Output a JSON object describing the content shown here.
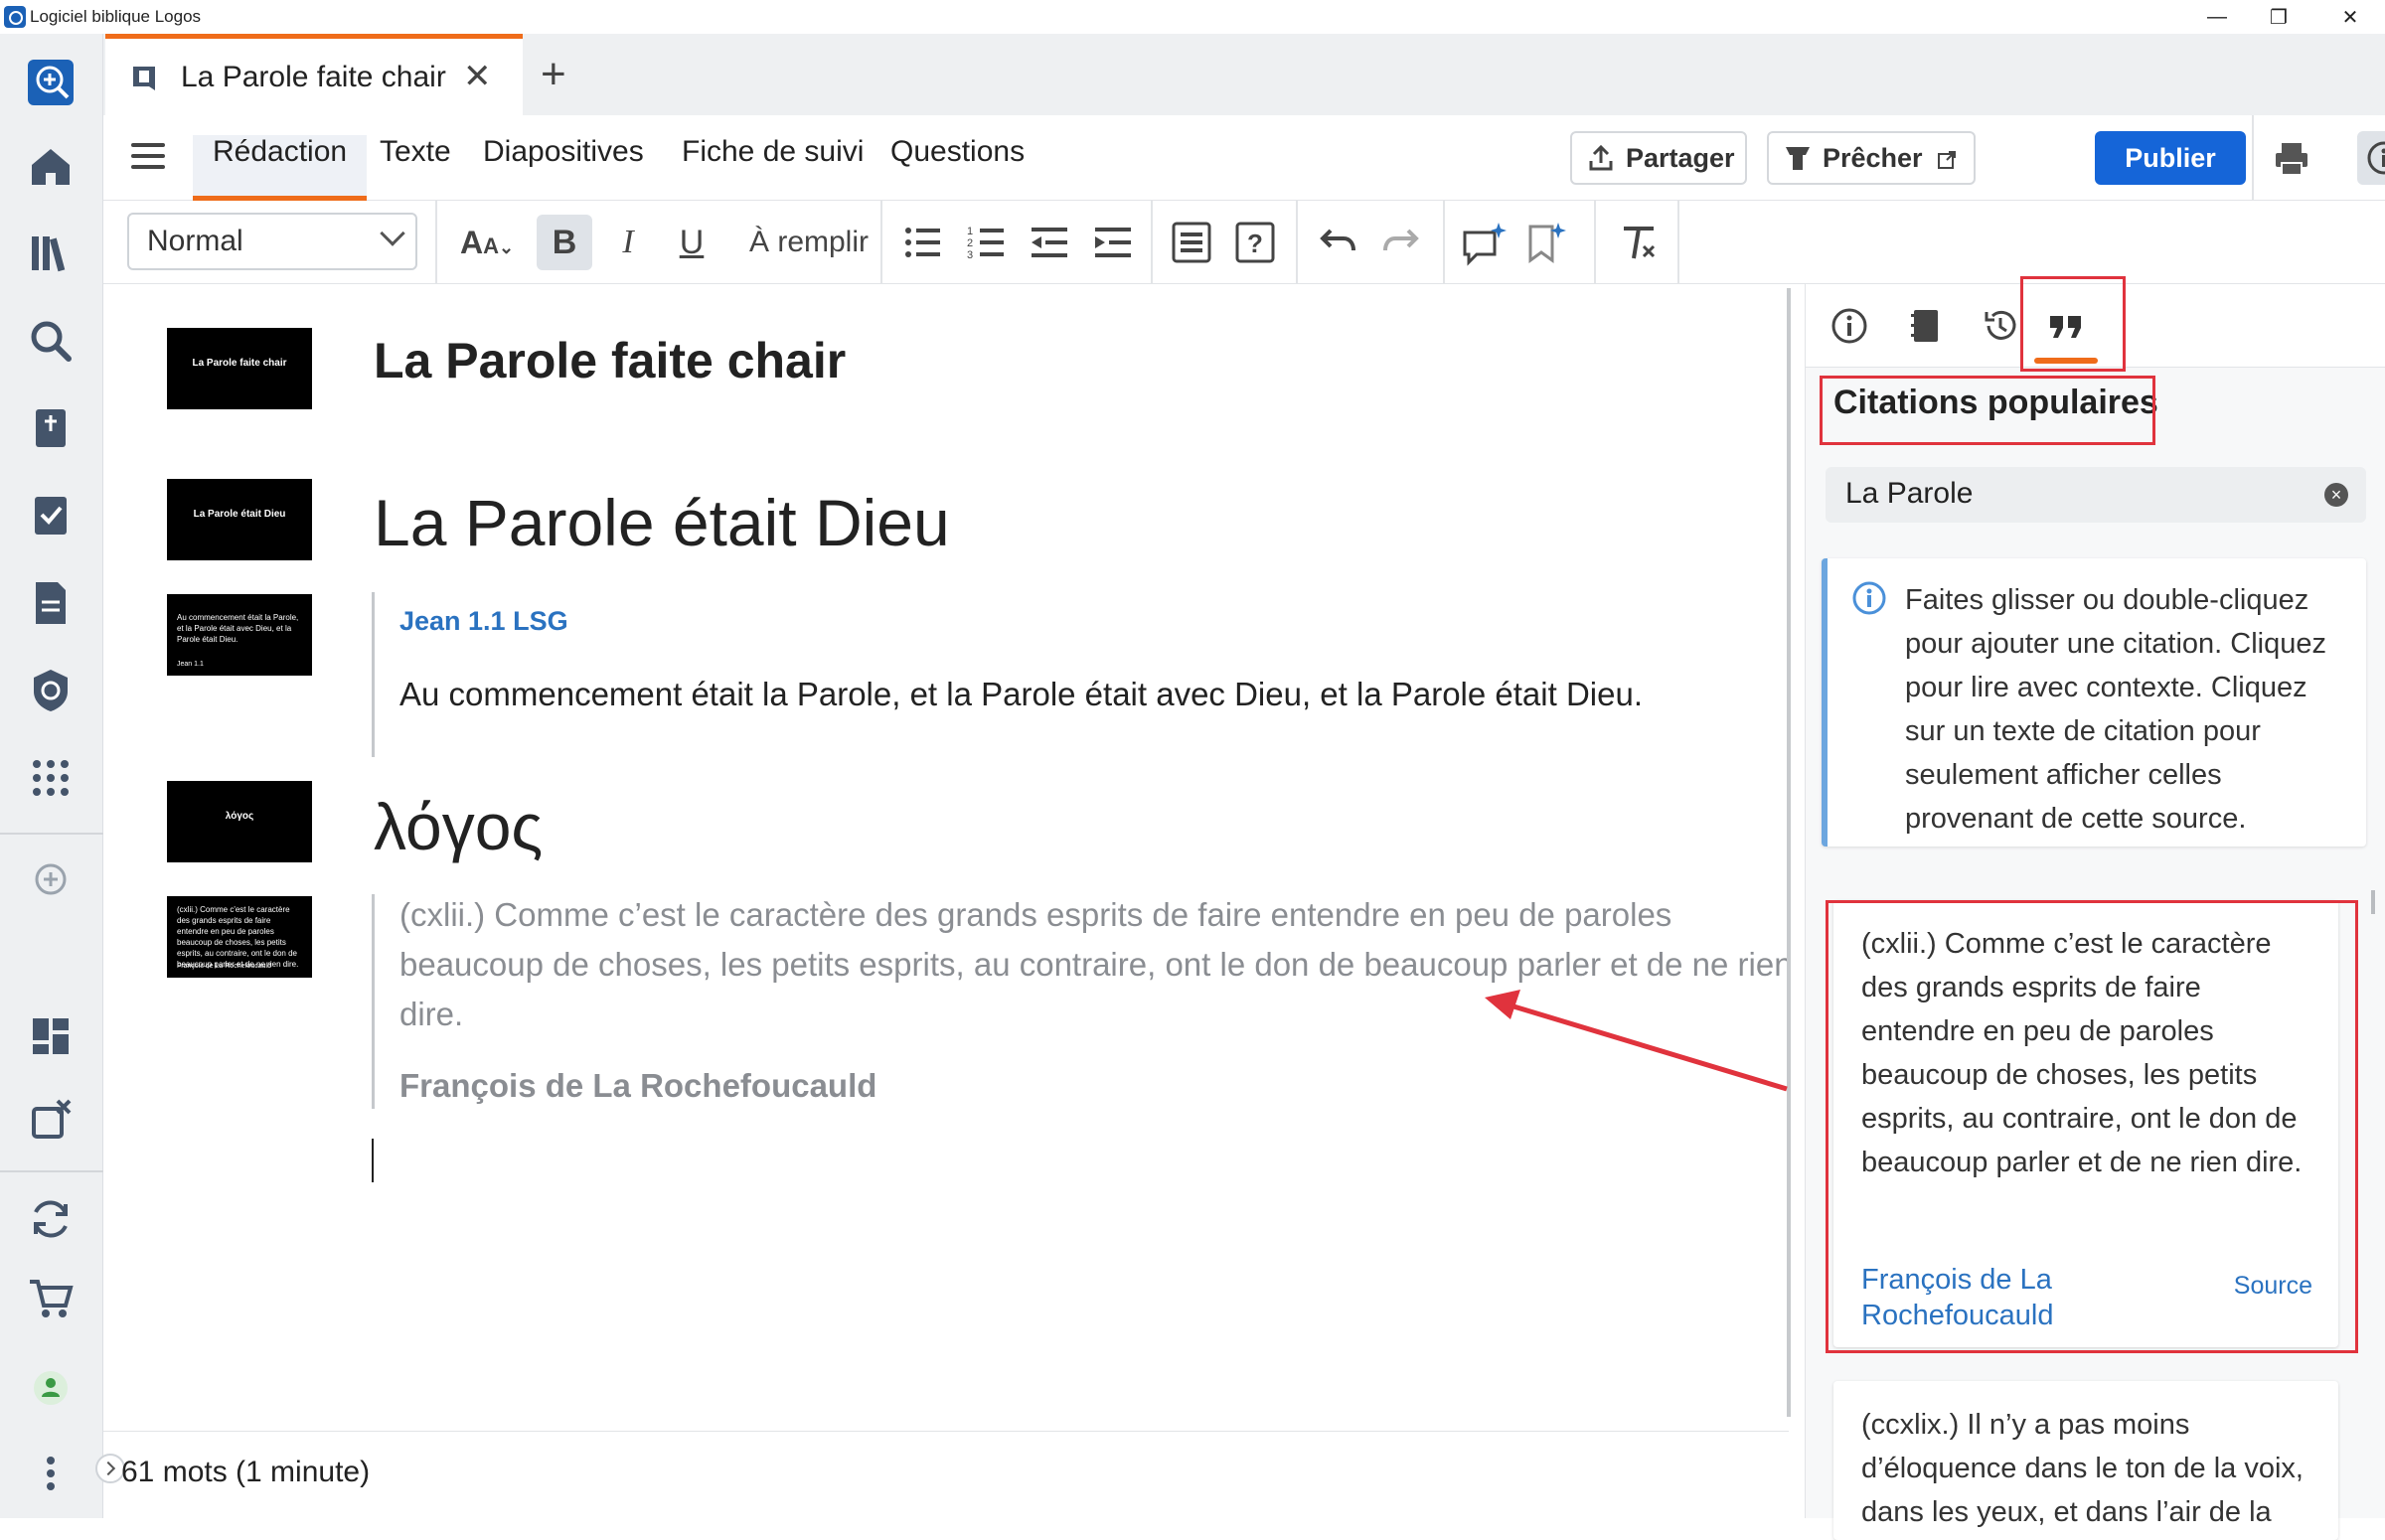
{
  "window": {
    "title": "Logiciel biblique Logos"
  },
  "tab": {
    "label": "La Parole faite chair"
  },
  "menu": {
    "tabs": [
      "Rédaction",
      "Texte",
      "Diapositives",
      "Fiche de suivi",
      "Questions"
    ]
  },
  "header_buttons": {
    "share": "Partager",
    "preach": "Prêcher",
    "publish": "Publier"
  },
  "toolbar": {
    "style": "Normal",
    "fill": "À remplir"
  },
  "editor": {
    "title": "La Parole faite chair",
    "heading1": "La Parole était Dieu",
    "ref": "Jean 1.1 LSG",
    "verse": "Au commencement était la Parole, et la Parole était avec Dieu, et la Parole était Dieu.",
    "heading2": "λόγος",
    "quote": "(cxlii.) Comme c’est le caractère des grands esprits de faire entendre en peu de paroles beaucoup de choses, les petits esprits, au contraire, ont le don de beaucoup parler et de ne rien dire.",
    "quote_author": "François de La Rochefoucauld"
  },
  "thumbs": {
    "t1": "La Parole faite chair",
    "t2": "La Parole était Dieu",
    "t3_text": "Au commencement était la Parole, et la Parole était avec Dieu, et la Parole était Dieu.",
    "t3_ref": "Jean 1.1",
    "t4": "λόγος",
    "t5_text": "(cxlii.) Comme c'est le caractère des grands esprits de faire entendre en peu de paroles beaucoup de choses, les petits esprits, au contraire, ont le don de beaucoup parler et de ne rien dire.",
    "t5_author": "François de La Rochefoucauld"
  },
  "status": {
    "words": "61 mots (1 minute)"
  },
  "panel": {
    "title": "Citations populaires",
    "search_value": "La Parole",
    "info": "Faites glisser ou double-cliquez pour ajouter une citation. Cliquez pour lire avec contexte. Cliquez sur un texte de citation pour seulement afficher celles provenant de cette source.",
    "quotes": [
      {
        "text": "(cxlii.) Comme c’est le caractère des grands esprits de faire entendre en peu de paroles beaucoup de choses, les petits esprits, au contraire, ont le don de beaucoup parler et de ne rien dire.",
        "author": "François de La Rochefoucauld",
        "source": "Source"
      },
      {
        "text": "(ccxlix.) Il n’y a pas moins d’éloquence dans le ton de la voix, dans les yeux, et dans l’air de la"
      }
    ]
  },
  "colors": {
    "accent": "#ef6c1a",
    "primary": "#1565d8",
    "link": "#2a72c0",
    "annotation": "#e0333d"
  }
}
